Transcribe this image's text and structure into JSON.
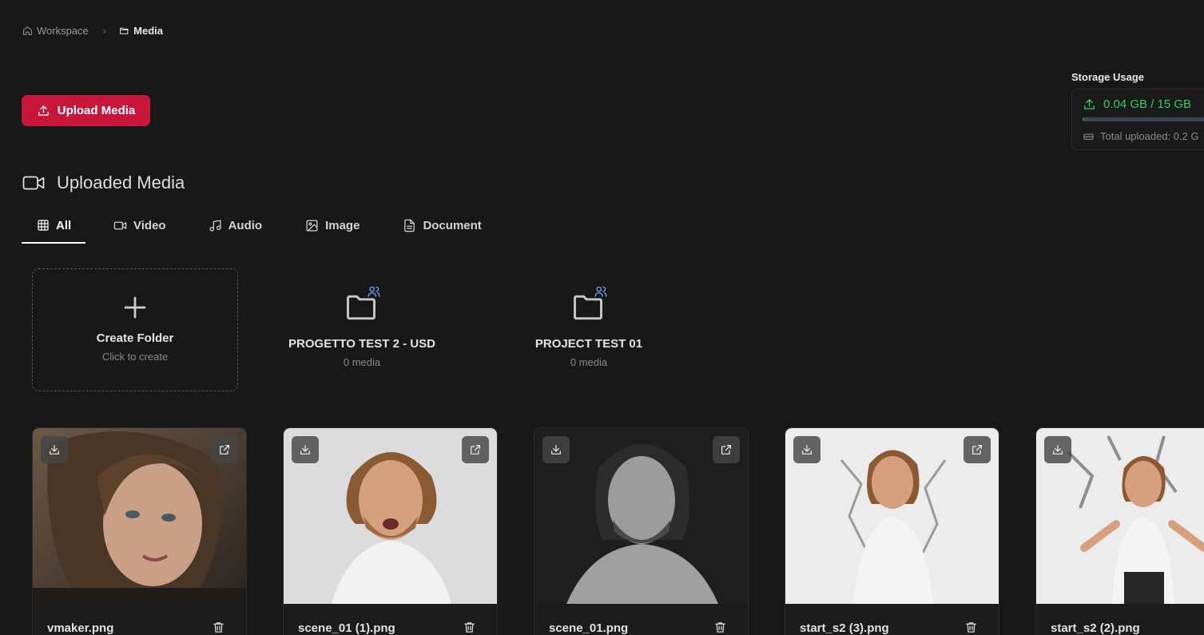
{
  "breadcrumb": {
    "workspace": "Workspace",
    "current": "Media"
  },
  "actions": {
    "upload_label": "Upload Media"
  },
  "storage": {
    "title": "Storage Usage",
    "used_label": "0.04 GB / 15 GB",
    "used_fraction": 0.0027,
    "total_uploaded": "Total uploaded: 0.2 G"
  },
  "section": {
    "title": "Uploaded Media"
  },
  "tabs": [
    {
      "label": "All",
      "icon": "grid-icon",
      "active": true
    },
    {
      "label": "Video",
      "icon": "video-icon"
    },
    {
      "label": "Audio",
      "icon": "music-icon"
    },
    {
      "label": "Image",
      "icon": "image-icon"
    },
    {
      "label": "Document",
      "icon": "document-icon"
    }
  ],
  "create_folder": {
    "title": "Create Folder",
    "subtitle": "Click to create"
  },
  "folders": [
    {
      "name": "PROGETTO TEST 2 - USD",
      "count": "0 media",
      "icon": "shared-folder-icon"
    },
    {
      "name": "PROJECT TEST 01",
      "count": "0 media",
      "icon": "shared-folder-icon"
    }
  ],
  "media": [
    {
      "name": "vmaker.png"
    },
    {
      "name": "scene_01 (1).png"
    },
    {
      "name": "scene_01.png"
    },
    {
      "name": "start_s2 (3).png"
    },
    {
      "name": "start_s2 (2).png"
    }
  ],
  "colors": {
    "accent": "#c8173a",
    "storage": "#2fcf63",
    "background": "#181818",
    "shared_badge": "#6aa8f0"
  }
}
